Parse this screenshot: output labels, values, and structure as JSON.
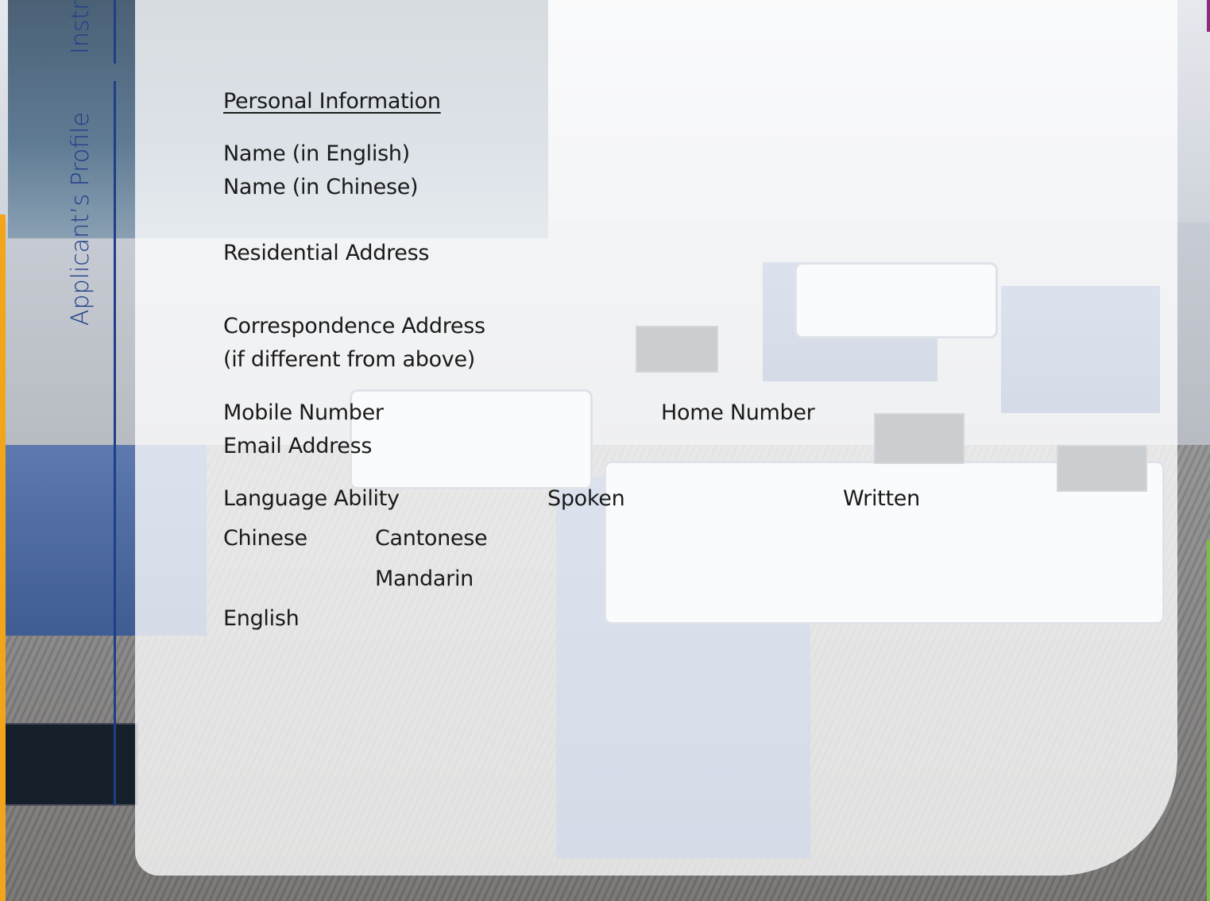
{
  "tabs": [
    {
      "label": "Instructions",
      "visible_label": "Instr"
    },
    {
      "label": "Applicant’s Profile"
    }
  ],
  "section_title": "Personal Information",
  "fields": {
    "name_english": "Name (in English)",
    "name_chinese": "Name (in Chinese)",
    "residential_address": "Residential Address",
    "correspondence_address": "Correspondence Address",
    "correspondence_note": "(if different from above)",
    "mobile_number": "Mobile Number",
    "home_number": "Home Number",
    "email_address": "Email Address"
  },
  "language": {
    "heading": "Language Ability",
    "spoken": "Spoken",
    "written": "Written",
    "chinese": "Chinese",
    "cantonese": "Cantonese",
    "mandarin": "Mandarin",
    "english": "English"
  },
  "colors": {
    "tab_accent": "#1f3e8a",
    "orange_bar": "#f2a51a",
    "green_bar": "#7ac143",
    "purple_bar": "#8b2d7f"
  }
}
